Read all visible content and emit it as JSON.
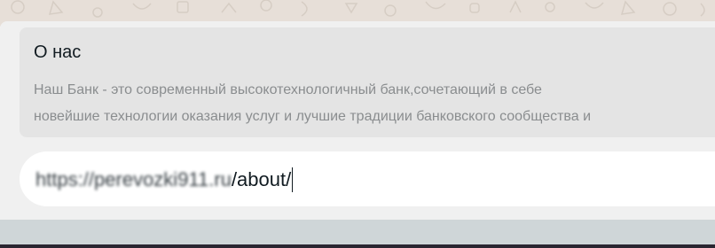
{
  "link_preview": {
    "title": "О нас",
    "description_line1": "Наш Банк - это современный высокотехнологичный банк,сочетающий в себе",
    "description_line2": "новейшие технологии оказания услуг и лучшие традиции банковского сообщества и"
  },
  "message_input": {
    "value_obscured": "https://perevozki911.ru",
    "value_visible": "/about/"
  },
  "colors": {
    "chat_wallpaper": "#e7dfd8",
    "panel_bg": "#f0f0f0",
    "preview_bg": "#e4e4e4",
    "input_bg": "#ffffff",
    "title_text": "#111b21",
    "description_text": "#8a8d8f"
  }
}
